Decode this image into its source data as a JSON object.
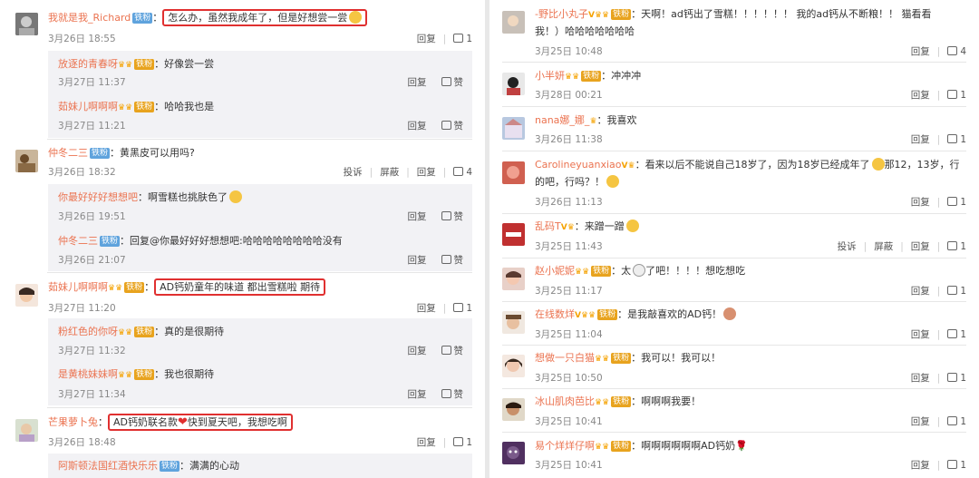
{
  "actions": {
    "reply": "回复",
    "like": "赞",
    "report": "投诉",
    "block": "屏蔽"
  },
  "left": {
    "c1": {
      "name": "我就是我_Richard",
      "badge": "铁粉",
      "text": "怎么办，虽然我成年了，但是好想尝一尝",
      "time": "3月26日 18:55",
      "likes": "1",
      "replies": [
        {
          "name": "放逐的青春呀",
          "badge": "铁粉",
          "text": "好像尝一尝",
          "time": "3月27日 11:37"
        },
        {
          "name": "茹妹儿啊啊啊",
          "badge": "铁粉",
          "text": "哈哈我也是",
          "time": "3月27日 11:21"
        }
      ]
    },
    "c2": {
      "name": "仲冬二三",
      "badge": "铁粉",
      "text": "黄黑皮可以用吗?",
      "time": "3月26日 18:32",
      "likes": "4",
      "replies": [
        {
          "name": "你最好好好想想吧",
          "text": "啊雪糕也挑肤色了",
          "time": "3月26日 19:51"
        },
        {
          "name": "仲冬二三",
          "badge": "铁粉",
          "text": "回复@你最好好好想想吧:哈哈哈哈哈哈哈哈没有",
          "time": "3月26日 21:07"
        }
      ]
    },
    "c3": {
      "name": "茹妹儿啊啊啊",
      "badge": "铁粉",
      "text": "AD钙奶童年的味道  都出雪糕啦  期待",
      "time": "3月27日 11:20",
      "likes": "1",
      "replies": [
        {
          "name": "粉红色的你呀",
          "badge": "铁粉",
          "text": "真的是很期待",
          "time": "3月27日 11:32"
        },
        {
          "name": "是黄桃妹妹啊",
          "badge": "铁粉",
          "text": "我也很期待",
          "time": "3月27日 11:34"
        }
      ]
    },
    "c4": {
      "name": "芒果萝卜兔",
      "text": "AD钙奶联名款",
      "text2": "快到夏天吧，我想吃啊",
      "time": "3月26日 18:48",
      "likes": "1",
      "replies": [
        {
          "name": "阿斯顿法国红酒快乐乐",
          "badge": "铁粉",
          "text": "满满的心动"
        }
      ]
    }
  },
  "right": [
    {
      "name": "-野比小丸子",
      "badge": "铁粉",
      "text": "天啊！ad钙出了雪糕！！！！！！  我的ad钙从不断粮！！  猫看看",
      "text2": "我！）哈哈哈哈哈哈哈",
      "time": "3月25日 10:48",
      "likes": "4"
    },
    {
      "name": "小半妍",
      "badge": "铁粉",
      "text": "冲冲冲",
      "time": "3月28日 00:21",
      "likes": "1"
    },
    {
      "name": "nana娜_娜_",
      "text": "我喜欢",
      "time": "3月26日 11:38",
      "likes": "1"
    },
    {
      "name": "Carolineyuanxiao",
      "text": "看来以后不能说自己18岁了，因为18岁已经成年了",
      "text_b": "那12，13岁，行",
      "text2": "的吧，行吗？！",
      "time": "3月26日 11:13",
      "likes": "1"
    },
    {
      "name": "乱码T",
      "text": "来蹭一蹭",
      "time": "3月25日 11:43",
      "likes": "1"
    },
    {
      "name": "赵小妮妮",
      "badge": "铁粉",
      "text": "太",
      "text_b": "了吧！！！！想吃想吃",
      "time": "3月25日 11:17",
      "likes": "1"
    },
    {
      "name": "在线数烊",
      "badge": "铁粉",
      "text": "是我敲喜欢的AD钙！",
      "time": "3月25日 11:04",
      "likes": "1"
    },
    {
      "name": "想做一只白猫",
      "badge": "铁粉",
      "text": "我可以！我可以！",
      "time": "3月25日 10:50",
      "likes": "1"
    },
    {
      "name": "冰山肌肉芭比",
      "badge": "铁粉",
      "text": "啊啊啊我要！",
      "time": "3月25日 10:41",
      "likes": "1"
    },
    {
      "name": "易个烊烊仔啊",
      "badge": "铁粉",
      "text": "啊啊啊啊啊啊AD钙奶",
      "time": "3月25日 10:41",
      "likes": "1"
    }
  ]
}
